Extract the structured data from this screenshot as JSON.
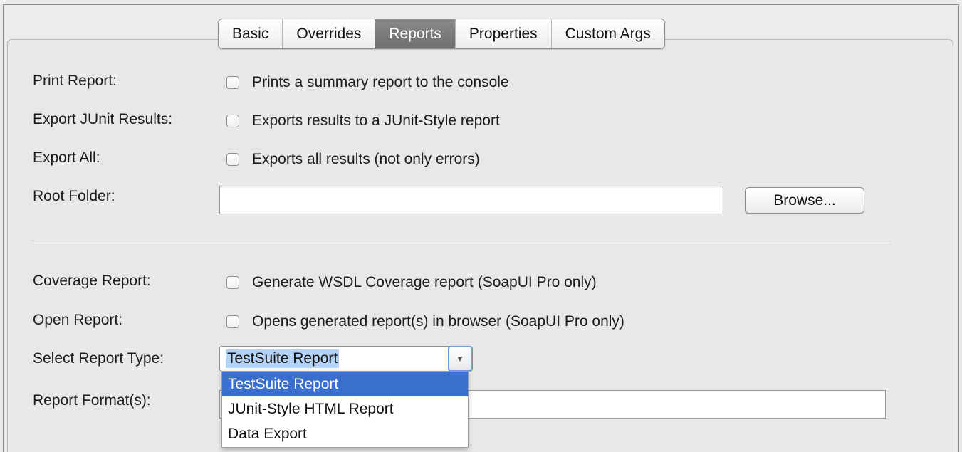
{
  "tabs": [
    {
      "label": "Basic",
      "active": false
    },
    {
      "label": "Overrides",
      "active": false
    },
    {
      "label": "Reports",
      "active": true
    },
    {
      "label": "Properties",
      "active": false
    },
    {
      "label": "Custom Args",
      "active": false
    }
  ],
  "print_report": {
    "label": "Print Report:",
    "checkbox_text": "Prints a summary report to the console",
    "checked": false
  },
  "export_junit": {
    "label": "Export JUnit Results:",
    "checkbox_text": "Exports results to a JUnit-Style report",
    "checked": false
  },
  "export_all": {
    "label": "Export All:",
    "checkbox_text": "Exports all results (not only errors)",
    "checked": false
  },
  "root_folder": {
    "label": "Root Folder:",
    "value": "",
    "browse_label": "Browse..."
  },
  "coverage_report": {
    "label": "Coverage Report:",
    "checkbox_text": "Generate WSDL Coverage report (SoapUI Pro only)",
    "checked": false
  },
  "open_report": {
    "label": "Open Report:",
    "checkbox_text": "Opens generated report(s) in browser (SoapUI Pro only)",
    "checked": false
  },
  "report_type": {
    "label": "Select Report Type:",
    "selected": "TestSuite Report",
    "options": [
      "TestSuite Report",
      "JUnit-Style HTML Report",
      "Data Export"
    ],
    "arrow_icon": "chevron-down-icon"
  },
  "report_formats": {
    "label": "Report Format(s):",
    "value": ""
  },
  "colors": {
    "selection": "#3a6fcd",
    "active_tab": "#7c7c7c",
    "focus_ring": "#6d9fe0"
  }
}
